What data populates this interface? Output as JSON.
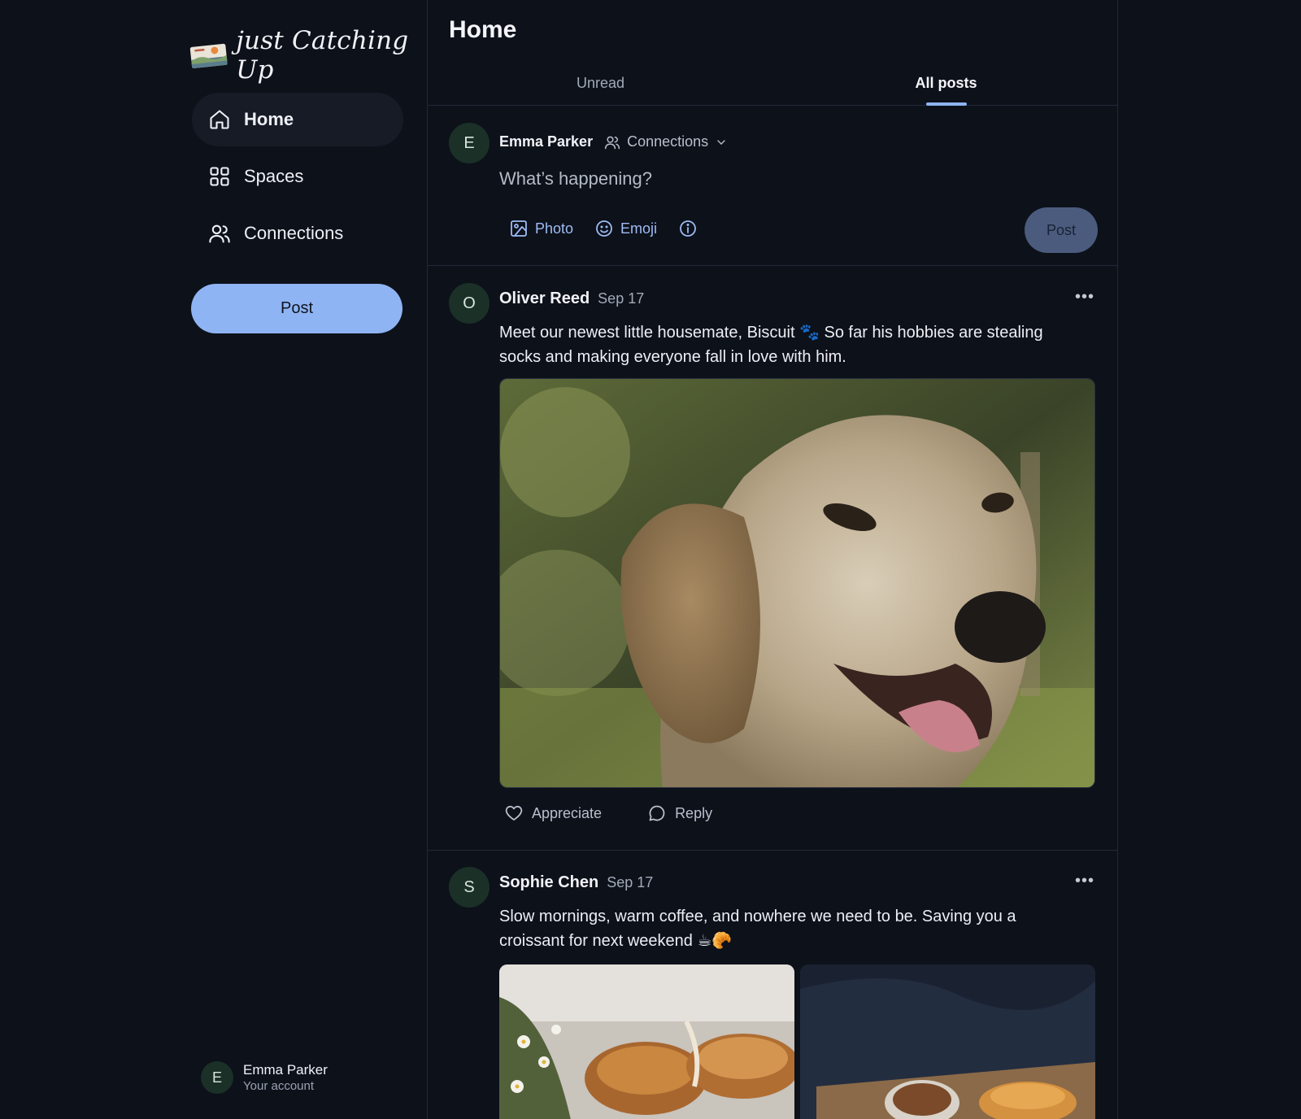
{
  "brand": {
    "name": "just Catching Up"
  },
  "sidebar": {
    "items": [
      {
        "label": "Home",
        "icon": "home-icon",
        "active": true
      },
      {
        "label": "Spaces",
        "icon": "grid-icon",
        "active": false
      },
      {
        "label": "Connections",
        "icon": "people-icon",
        "active": false
      }
    ],
    "post_label": "Post",
    "account": {
      "initial": "E",
      "name": "Emma Parker",
      "subtitle": "Your account"
    }
  },
  "main": {
    "title": "Home",
    "tabs": [
      {
        "label": "Unread",
        "active": false
      },
      {
        "label": "All posts",
        "active": true
      }
    ]
  },
  "composer": {
    "initial": "E",
    "name": "Emma Parker",
    "audience": "Connections",
    "placeholder": "What’s happening?",
    "photo_label": "Photo",
    "emoji_label": "Emoji",
    "post_label": "Post"
  },
  "posts": [
    {
      "initial": "O",
      "author": "Oliver Reed",
      "date": "Sep 17",
      "text": "Meet our newest little housemate, Biscuit 🐾 So far his hobbies are stealing socks and making everyone fall in love with him.",
      "appreciate_label": "Appreciate",
      "reply_label": "Reply"
    },
    {
      "initial": "S",
      "author": "Sophie Chen",
      "date": "Sep 17",
      "text": "Slow mornings, warm coffee, and nowhere we need to be. Saving you a croissant for next weekend ☕🥐"
    }
  ],
  "colors": {
    "background": "#0d111a",
    "accent": "#8fb4f4",
    "avatar_bg": "#1b3027",
    "muted_button": "#4a5b7e"
  }
}
